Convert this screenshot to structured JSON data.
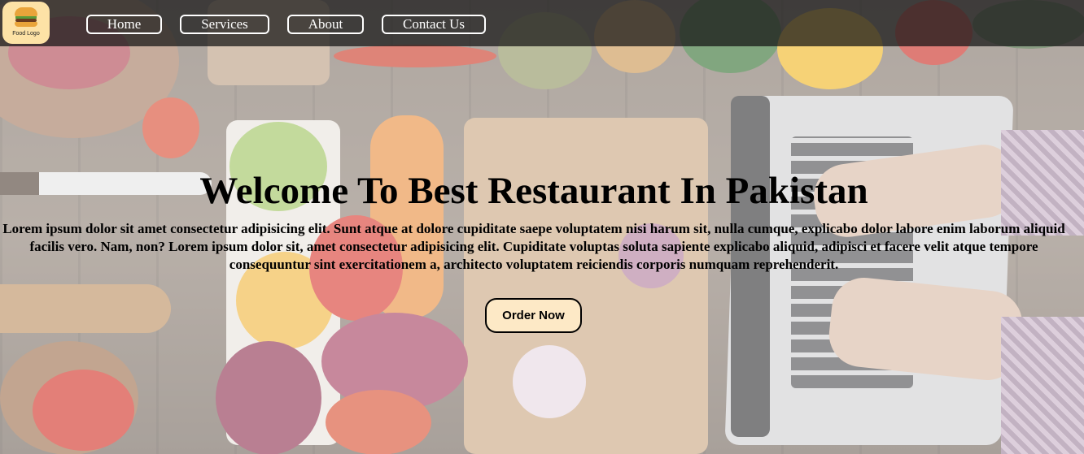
{
  "navbar": {
    "logo_text": "Food Logo",
    "links": [
      {
        "label": "Home"
      },
      {
        "label": "Services"
      },
      {
        "label": "About"
      },
      {
        "label": "Contact Us"
      }
    ]
  },
  "hero": {
    "title": "Welcome To Best Restaurant In Pakistan",
    "text": "Lorem ipsum dolor sit amet consectetur adipisicing elit. Sunt atque at dolore cupiditate saepe voluptatem nisi harum sit, nulla cumque, explicabo dolor labore enim laborum aliquid facilis vero. Nam, non? Lorem ipsum dolor sit, amet consectetur adipisicing elit. Cupiditate voluptas soluta sapiente explicabo aliquid, adipisci et facere velit atque tempore consequuntur sint exercitationem a, architecto voluptatem reiciendis corporis numquam reprehenderit.",
    "button_label": "Order Now"
  },
  "colors": {
    "navbar_bg": "#141414",
    "button_bg": "#fde9c6",
    "logo_bg": "#fde2a6"
  },
  "icons": {
    "logo": "burger-icon"
  }
}
